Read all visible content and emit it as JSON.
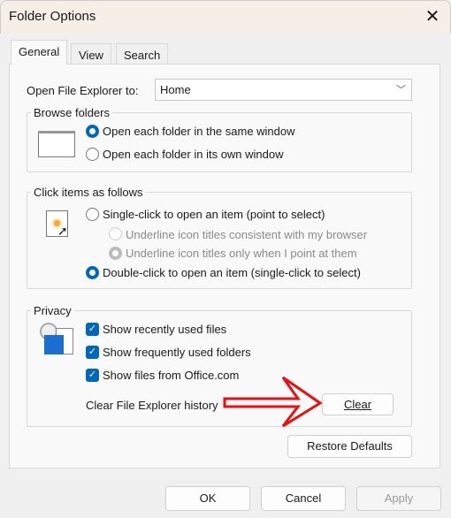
{
  "window": {
    "title": "Folder Options",
    "close_icon": "close-icon"
  },
  "tabs": [
    {
      "label": "General",
      "active": true
    },
    {
      "label": "View"
    },
    {
      "label": "Search"
    }
  ],
  "open_to": {
    "label": "Open File Explorer to:",
    "value": "Home"
  },
  "browse": {
    "label": "Browse folders",
    "options": [
      {
        "label": "Open each folder in the same window",
        "selected": true
      },
      {
        "label": "Open each folder in its own window",
        "selected": false
      }
    ]
  },
  "click": {
    "label": "Click items as follows",
    "single": "Single-click to open an item (point to select)",
    "sub1": "Underline icon titles consistent with my browser",
    "sub2": "Underline icon titles only when I point at them",
    "double": "Double-click to open an item (single-click to select)",
    "selected": "double"
  },
  "privacy": {
    "label": "Privacy",
    "items": [
      {
        "label": "Show recently used files",
        "checked": true
      },
      {
        "label": "Show frequently used folders",
        "checked": true
      },
      {
        "label": "Show files from Office.com",
        "checked": true
      }
    ],
    "clear_label": "Clear File Explorer history",
    "clear_button": "Clear",
    "arrow_color": "#e81010"
  },
  "restore_button": "Restore Defaults",
  "footer": {
    "ok": "OK",
    "cancel": "Cancel",
    "apply": "Apply"
  },
  "colors": {
    "accent": "#0067c0"
  }
}
